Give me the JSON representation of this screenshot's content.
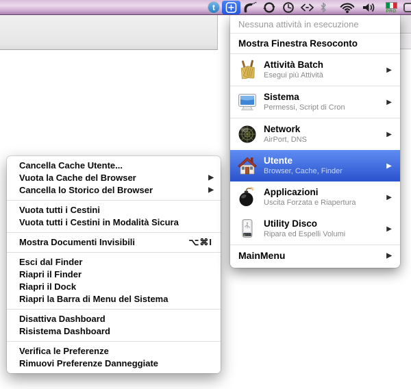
{
  "glyphs": {
    "submenu_arrow": "▶"
  },
  "menubar": {
    "icons": [
      {
        "name": "twitter-icon",
        "glyph": "t"
      },
      {
        "name": "mainmenu-plus-icon",
        "selected": true
      },
      {
        "name": "phone-icon"
      },
      {
        "name": "sync-icon"
      },
      {
        "name": "time-machine-icon"
      },
      {
        "name": "code-icon"
      },
      {
        "name": "bluetooth-icon"
      },
      {
        "name": "wifi-icon"
      },
      {
        "name": "volume-icon"
      },
      {
        "name": "italian-flag-icon",
        "badge": "PRO"
      },
      {
        "name": "clipped-menu-extra-icon"
      }
    ],
    "selected_bg": "#2d66ef",
    "bar_top_color": "#d9bcdb",
    "bar_bottom_color": "#af88b4"
  },
  "right_menu": {
    "status_item": "Nessuna attività in esecuzione",
    "show_report_item": "Mostra Finestra Resoconto",
    "items": [
      {
        "title": "Attività Batch",
        "subtitle": "Esegui più Attività",
        "icon": "brooms",
        "submenu": true
      },
      {
        "title": "Sistema",
        "subtitle": "Permessi, Script di Cron",
        "icon": "display",
        "submenu": true
      },
      {
        "title": "Network",
        "subtitle": "AirPort, DNS",
        "icon": "globe",
        "submenu": true
      },
      {
        "title": "Utente",
        "subtitle": "Browser, Cache, Finder",
        "icon": "home",
        "submenu": true,
        "selected": true
      },
      {
        "title": "Applicazioni",
        "subtitle": "Uscita Forzata e Riapertura",
        "icon": "bomb",
        "submenu": true
      },
      {
        "title": "Utility Disco",
        "subtitle": "Ripara ed Espelli Volumi",
        "icon": "disk",
        "submenu": true
      }
    ],
    "footer_item": "MainMenu",
    "selection_color_top": "#5f8df2",
    "selection_color_bottom": "#2a52cd"
  },
  "left_menu": {
    "items": [
      {
        "label": "Cancella Cache Utente..."
      },
      {
        "label": "Vuota la Cache del Browser",
        "submenu": true
      },
      {
        "label": "Cancella lo Storico del Browser",
        "submenu": true
      },
      {
        "label": "Vuota tutti i Cestini"
      },
      {
        "label": "Vuota tutti i Cestini in Modalità Sicura"
      },
      {
        "label": "Mostra Documenti Invisibili",
        "shortcut": "⌥⌘I"
      },
      {
        "label": "Esci dal Finder"
      },
      {
        "label": "Riapri il Finder"
      },
      {
        "label": "Riapri il Dock"
      },
      {
        "label": "Riapri la Barra di Menu del Sistema"
      },
      {
        "label": "Disattiva Dashboard"
      },
      {
        "label": "Risistema Dashboard"
      },
      {
        "label": "Verifica le Preferenze"
      },
      {
        "label": "Rimuovi Preferenze Danneggiate"
      }
    ]
  }
}
